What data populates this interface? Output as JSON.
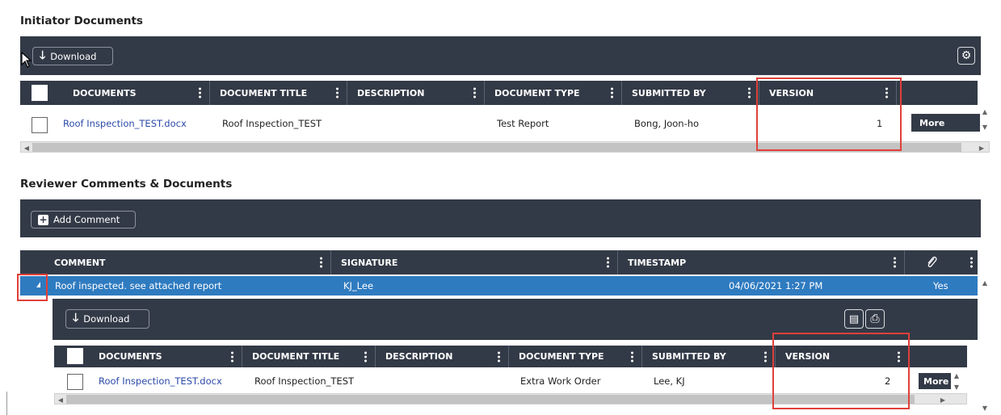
{
  "initiator": {
    "title": "Initiator Documents",
    "toolbar": {
      "download_label": "Download",
      "download_icon": "download-arrow-icon",
      "settings_icon": "gear-icon"
    },
    "columns": [
      "DOCUMENTS",
      "DOCUMENT TITLE",
      "DESCRIPTION",
      "DOCUMENT TYPE",
      "SUBMITTED BY",
      "VERSION"
    ],
    "rows": [
      {
        "document": "Roof Inspection_TEST.docx",
        "title": "Roof Inspection_TEST",
        "description": "",
        "type": "Test Report",
        "submitted_by": "Bong, Joon-ho",
        "version": "1",
        "action": "More"
      }
    ]
  },
  "reviewer": {
    "title": "Reviewer Comments & Documents",
    "toolbar": {
      "add_comment_label": "Add Comment",
      "add_icon": "plus-square-icon"
    },
    "columns": [
      "COMMENT",
      "SIGNATURE",
      "TIMESTAMP"
    ],
    "attachment_icon": "paperclip-icon",
    "rows": [
      {
        "comment": "Roof inspected. see attached report",
        "signature": "KJ_Lee",
        "timestamp": "04/06/2021 1:27 PM",
        "has_attachment": "Yes",
        "expanded": true
      }
    ],
    "nested": {
      "download_label": "Download",
      "columns": [
        "DOCUMENTS",
        "DOCUMENT TITLE",
        "DESCRIPTION",
        "DOCUMENT TYPE",
        "SUBMITTED BY",
        "VERSION"
      ],
      "rows": [
        {
          "document": "Roof Inspection_TEST.docx",
          "title": "Roof Inspection_TEST",
          "description": "",
          "type": "Extra Work Order",
          "submitted_by": "Lee, KJ",
          "version": "2",
          "action": "More"
        }
      ]
    }
  },
  "colors": {
    "toolbar_bg": "#333a47",
    "selected_row": "#2f7bc0",
    "link": "#2b4aa8",
    "highlight": "#e0403a"
  }
}
